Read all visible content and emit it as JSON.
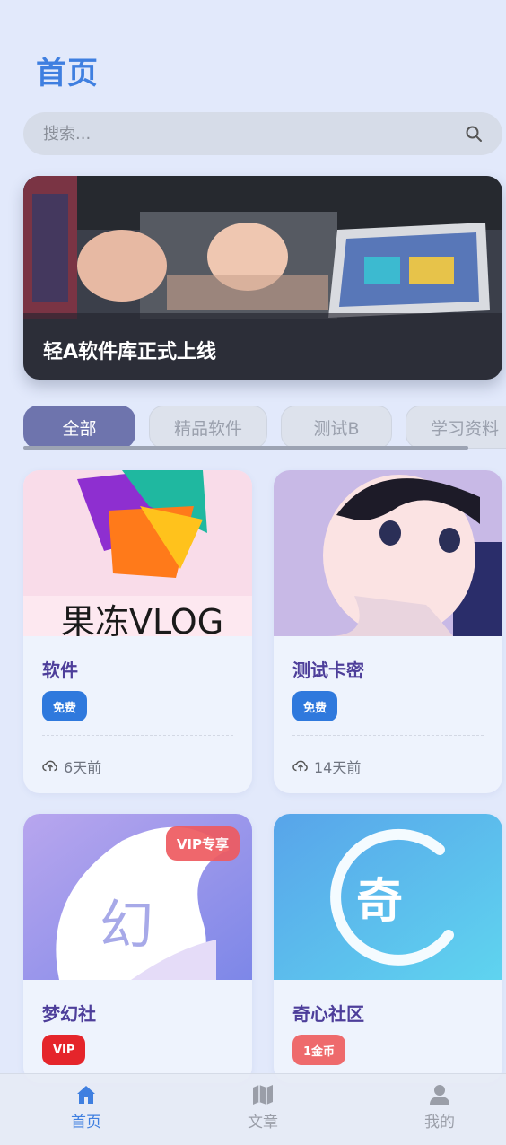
{
  "header": {
    "title": "首页"
  },
  "search": {
    "placeholder": "搜索..."
  },
  "banner": {
    "title": "轻A软件库正式上线"
  },
  "tabs": [
    {
      "label": "全部",
      "active": true
    },
    {
      "label": "精品软件",
      "active": false
    },
    {
      "label": "测试B",
      "active": false
    },
    {
      "label": "学习资料",
      "active": false
    }
  ],
  "cards": [
    {
      "title": "软件",
      "badge": "免费",
      "meta": "6天前",
      "thumb_text": "果冻VLOG"
    },
    {
      "title": "测试卡密",
      "badge": "免费",
      "meta": "14天前"
    },
    {
      "title": "梦幻社",
      "badge": "VIP",
      "tag": "VIP专享",
      "thumb_text": "幻"
    },
    {
      "title": "奇心社区",
      "badge": "1金币",
      "thumb_text": "奇"
    }
  ],
  "bottom_nav": [
    {
      "label": "首页",
      "icon": "home-icon",
      "active": true
    },
    {
      "label": "文章",
      "icon": "map-icon",
      "active": false
    },
    {
      "label": "我的",
      "icon": "user-icon",
      "active": false
    }
  ],
  "colors": {
    "accent": "#3f7fe0",
    "tab_active": "#6e74ad",
    "badge_free": "#2f79dd",
    "badge_vip": "#e5252b",
    "badge_coin": "#ee6a6c",
    "card_title": "#4d3e9a"
  }
}
